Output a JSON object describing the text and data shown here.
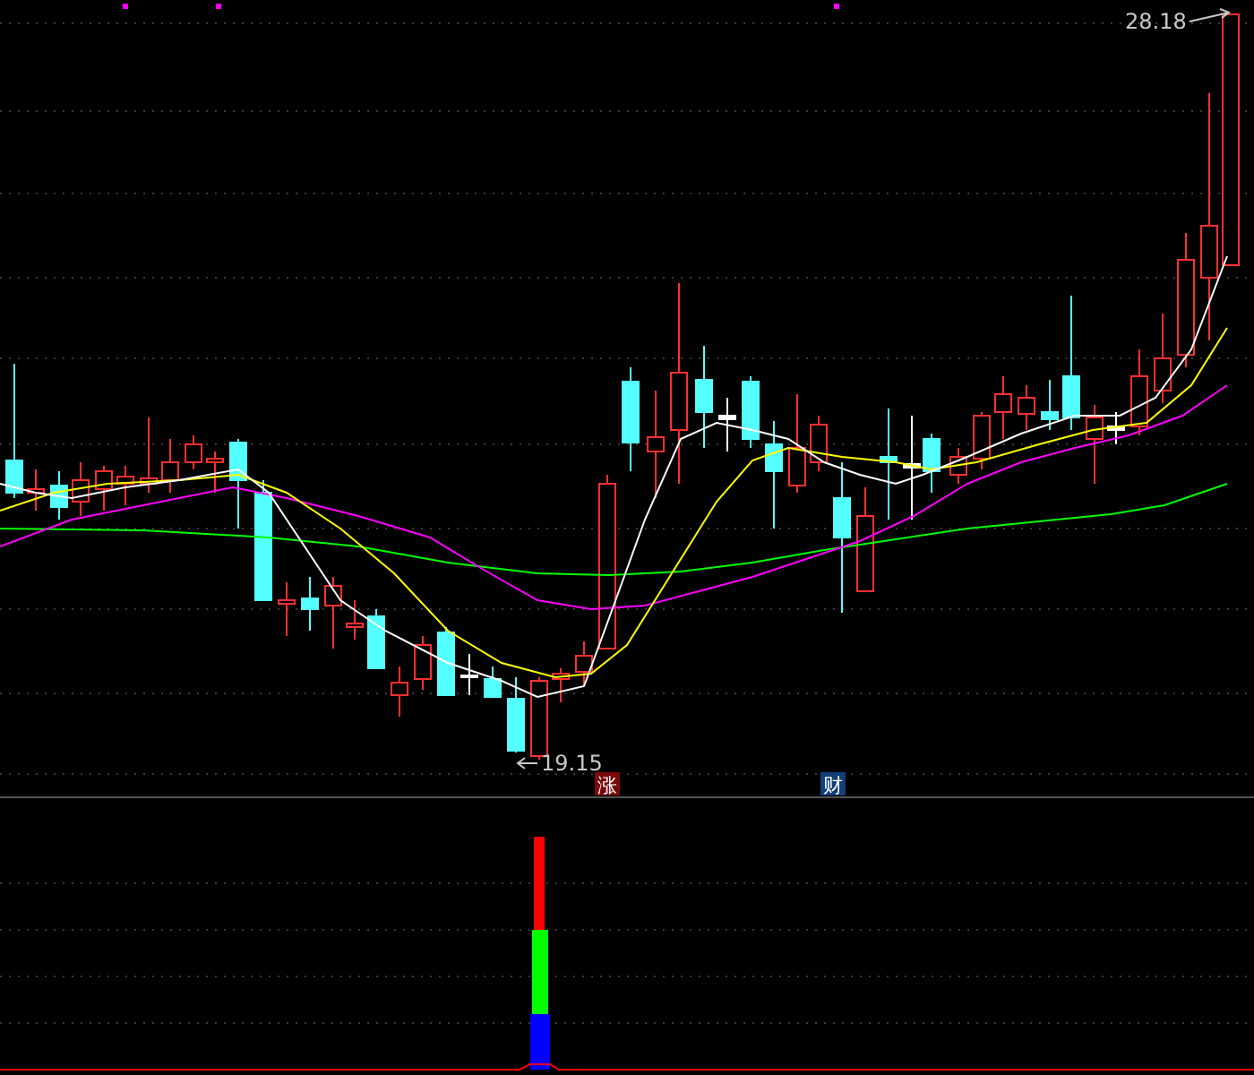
{
  "price_panel": {
    "high_label": "28.18",
    "low_label": "19.15",
    "badges": [
      {
        "text": "涨",
        "color": "#7a0a0a"
      },
      {
        "text": "财",
        "color": "#123f7a"
      }
    ]
  }
}
